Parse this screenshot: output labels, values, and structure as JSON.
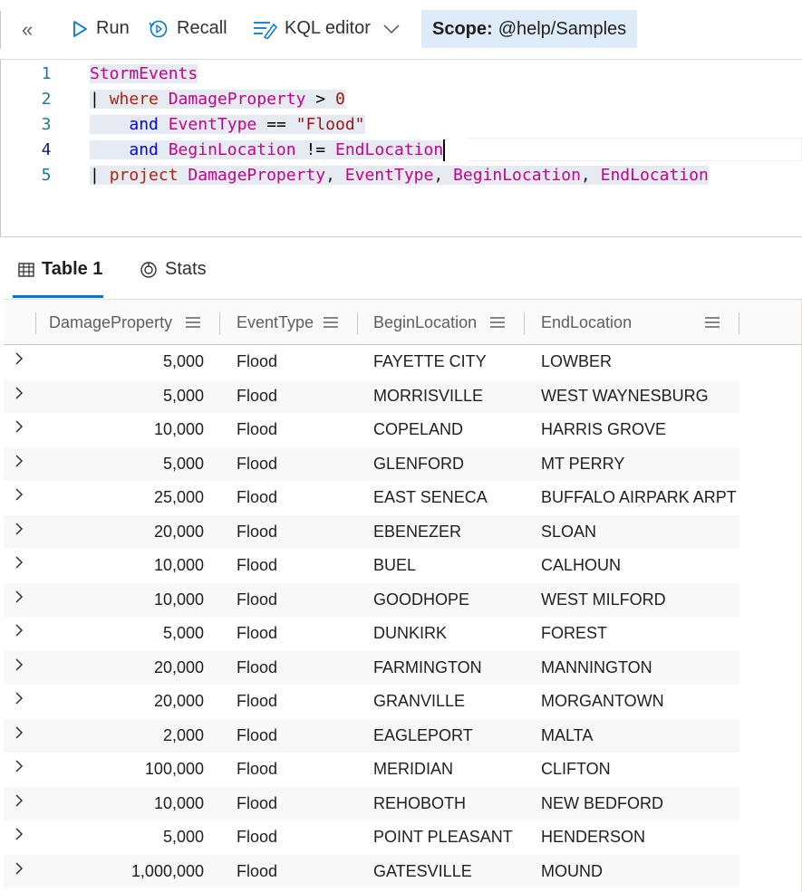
{
  "toolbar": {
    "run_label": "Run",
    "recall_label": "Recall",
    "editor_mode_label": "KQL editor",
    "scope_label": "Scope:",
    "scope_value": "@help/Samples"
  },
  "editor": {
    "line_numbers": [
      "1",
      "2",
      "3",
      "4",
      "5"
    ],
    "lines": [
      "StormEvents",
      "| where DamageProperty > 0",
      "    and EventType == \"Flood\"",
      "    and BeginLocation != EndLocation",
      "| project DamageProperty, EventType, BeginLocation, EndLocation"
    ]
  },
  "tabs": [
    {
      "label": "Table 1",
      "icon": "table-icon",
      "active": true
    },
    {
      "label": "Stats",
      "icon": "stats-icon",
      "active": false
    }
  ],
  "table": {
    "columns": [
      "DamageProperty",
      "EventType",
      "BeginLocation",
      "EndLocation"
    ],
    "rows": [
      [
        "5,000",
        "Flood",
        "FAYETTE CITY",
        "LOWBER"
      ],
      [
        "5,000",
        "Flood",
        "MORRISVILLE",
        "WEST WAYNESBURG"
      ],
      [
        "10,000",
        "Flood",
        "COPELAND",
        "HARRIS GROVE"
      ],
      [
        "5,000",
        "Flood",
        "GLENFORD",
        "MT PERRY"
      ],
      [
        "25,000",
        "Flood",
        "EAST SENECA",
        "BUFFALO AIRPARK ARPT"
      ],
      [
        "20,000",
        "Flood",
        "EBENEZER",
        "SLOAN"
      ],
      [
        "10,000",
        "Flood",
        "BUEL",
        "CALHOUN"
      ],
      [
        "10,000",
        "Flood",
        "GOODHOPE",
        "WEST MILFORD"
      ],
      [
        "5,000",
        "Flood",
        "DUNKIRK",
        "FOREST"
      ],
      [
        "20,000",
        "Flood",
        "FARMINGTON",
        "MANNINGTON"
      ],
      [
        "20,000",
        "Flood",
        "GRANVILLE",
        "MORGANTOWN"
      ],
      [
        "2,000",
        "Flood",
        "EAGLEPORT",
        "MALTA"
      ],
      [
        "100,000",
        "Flood",
        "MERIDIAN",
        "CLIFTON"
      ],
      [
        "10,000",
        "Flood",
        "REHOBOTH",
        "NEW BEDFORD"
      ],
      [
        "5,000",
        "Flood",
        "POINT PLEASANT",
        "HENDERSON"
      ],
      [
        "1,000,000",
        "Flood",
        "GATESVILLE",
        "MOUND"
      ]
    ]
  },
  "colors": {
    "accent": "#0078d4",
    "scope_bg": "#deecf9"
  }
}
